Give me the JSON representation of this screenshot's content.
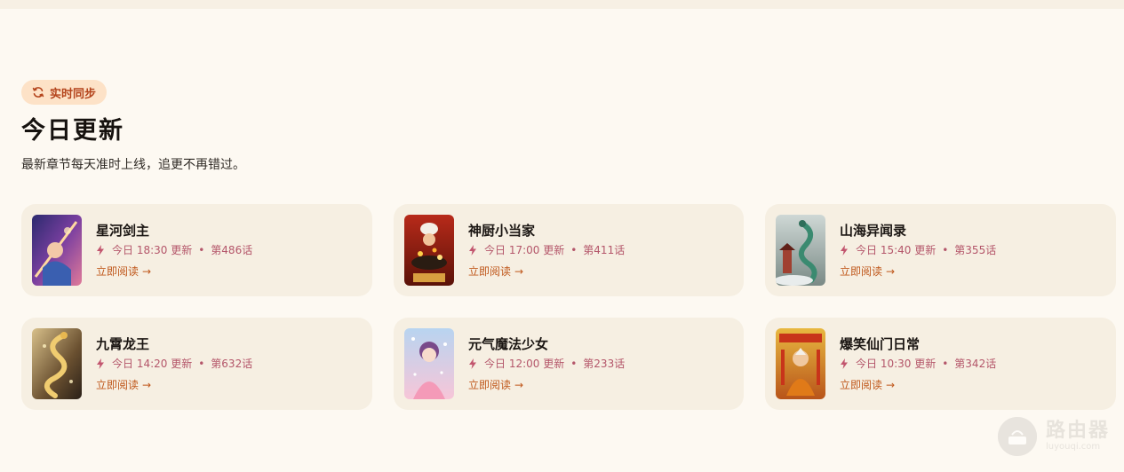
{
  "section": {
    "badge": {
      "label": "实时同步",
      "icon": "refresh-icon"
    },
    "title": "今日更新",
    "subtitle": "最新章节每天准时上线，追更不再错过。"
  },
  "colors": {
    "page_bg": "#fdf9f2",
    "card_bg": "#f6efe2",
    "badge_bg": "#fde2c7",
    "badge_text": "#b4441c",
    "meta_text": "#b4566a",
    "link_text": "#c0581c"
  },
  "updates": [
    {
      "title": "星河剑主",
      "time": "今日 18:30 更新",
      "chapter": "第486话",
      "action": "立即阅读",
      "cover": "sword-hero-cover"
    },
    {
      "title": "神厨小当家",
      "time": "今日 17:00 更新",
      "chapter": "第411话",
      "action": "立即阅读",
      "cover": "chef-cover"
    },
    {
      "title": "山海异闻录",
      "time": "今日 15:40 更新",
      "chapter": "第355话",
      "action": "立即阅读",
      "cover": "dragon-mountain-cover"
    },
    {
      "title": "九霄龙王",
      "time": "今日 14:20 更新",
      "chapter": "第632话",
      "action": "立即阅读",
      "cover": "golden-dragon-cover"
    },
    {
      "title": "元气魔法少女",
      "time": "今日 12:00 更新",
      "chapter": "第233话",
      "action": "立即阅读",
      "cover": "magical-girl-cover"
    },
    {
      "title": "爆笑仙门日常",
      "time": "今日 10:30 更新",
      "chapter": "第342话",
      "action": "立即阅读",
      "cover": "immortal-sect-cover"
    }
  ],
  "meta_separator": "•",
  "read_arrow": "→",
  "watermark": {
    "cn": "路由器",
    "en": "luyouqi.com"
  }
}
